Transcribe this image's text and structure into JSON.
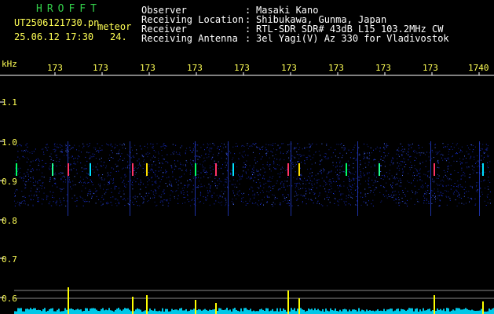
{
  "header": {
    "app_title": "HROFFT",
    "file_name": "UT2506121730.pn",
    "mode": "meteor",
    "date_time": "25.06.12 17:30",
    "count": "24."
  },
  "info": [
    {
      "label": "Observer",
      "value": "Masaki Kano"
    },
    {
      "label": "Receiving Location",
      "value": "Shibukawa, Gunma, Japan"
    },
    {
      "label": "Receiver",
      "value": "RTL-SDR SDR# 43dB L15 103.2MHz CW"
    },
    {
      "label": "Receiving Antenna",
      "value": "3el Yagi(V) Az 330 for Vladivostok"
    }
  ],
  "colon": ":",
  "axis": {
    "y_unit": "kHz",
    "y_ticks": [
      "1.1",
      "1.0",
      "0.9",
      "0.8",
      "0.7",
      "0.6"
    ],
    "x_ticks": [
      "173",
      "173",
      "173",
      "173",
      "173",
      "173",
      "173",
      "173",
      "173",
      "1740"
    ]
  },
  "colors": {
    "background": "#000000",
    "text_yellow": "#ffff55",
    "title_green": "#33d04a",
    "noise_blue": "#1a2fd8",
    "level_cyan": "#00c8e8",
    "peak_yellow": "#ffff00"
  }
}
